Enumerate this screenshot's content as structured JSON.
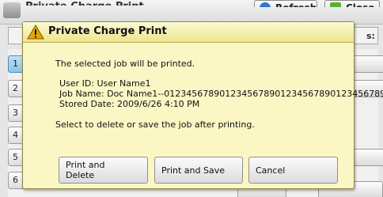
{
  "background": {
    "title": "Private Charge Print",
    "refresh_label": "Refresh",
    "close_label": "Close",
    "status_column_fragment": "s:",
    "row_numbers": [
      "1",
      "2",
      "3",
      "4",
      "5",
      "6"
    ],
    "selected_row": "1"
  },
  "dialog": {
    "title": "Private Charge Print",
    "icon": "warning-triangle-icon",
    "message": "The selected job will be printed.",
    "user_id": "User ID: User Name1",
    "job_name": "Job Name: Doc Name1--0123456789012345678901234567890123456789",
    "stored_date": "Stored Date: 2009/6/26 4:10 PM",
    "instruction": "Select to delete or save the job after printing.",
    "buttons": {
      "print_delete_line1": "Print and",
      "print_delete_line2": "Delete",
      "print_save": "Print and Save",
      "cancel": "Cancel"
    }
  },
  "colors": {
    "dialog_bg": "#fbf7c4",
    "warning_icon": "#e9a500"
  }
}
